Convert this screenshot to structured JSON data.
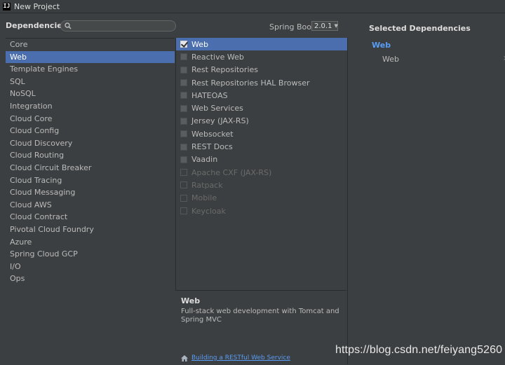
{
  "window": {
    "title": "New Project",
    "app_icon": "IJ"
  },
  "header": {
    "dependencies_label": "Dependencies",
    "search_placeholder": "",
    "spring_boot_label": "Spring Boot",
    "spring_boot_version": "2.0.1",
    "selected_dependencies_label": "Selected Dependencies"
  },
  "categories": [
    {
      "label": "Core",
      "selected": false
    },
    {
      "label": "Web",
      "selected": true
    },
    {
      "label": "Template Engines",
      "selected": false
    },
    {
      "label": "SQL",
      "selected": false
    },
    {
      "label": "NoSQL",
      "selected": false
    },
    {
      "label": "Integration",
      "selected": false
    },
    {
      "label": "Cloud Core",
      "selected": false
    },
    {
      "label": "Cloud Config",
      "selected": false
    },
    {
      "label": "Cloud Discovery",
      "selected": false
    },
    {
      "label": "Cloud Routing",
      "selected": false
    },
    {
      "label": "Cloud Circuit Breaker",
      "selected": false
    },
    {
      "label": "Cloud Tracing",
      "selected": false
    },
    {
      "label": "Cloud Messaging",
      "selected": false
    },
    {
      "label": "Cloud AWS",
      "selected": false
    },
    {
      "label": "Cloud Contract",
      "selected": false
    },
    {
      "label": "Pivotal Cloud Foundry",
      "selected": false
    },
    {
      "label": "Azure",
      "selected": false
    },
    {
      "label": "Spring Cloud GCP",
      "selected": false
    },
    {
      "label": "I/O",
      "selected": false
    },
    {
      "label": "Ops",
      "selected": false
    }
  ],
  "dependencies": [
    {
      "label": "Web",
      "checked": true,
      "selected": true,
      "disabled": false
    },
    {
      "label": "Reactive Web",
      "checked": false,
      "selected": false,
      "disabled": false
    },
    {
      "label": "Rest Repositories",
      "checked": false,
      "selected": false,
      "disabled": false
    },
    {
      "label": "Rest Repositories HAL Browser",
      "checked": false,
      "selected": false,
      "disabled": false
    },
    {
      "label": "HATEOAS",
      "checked": false,
      "selected": false,
      "disabled": false
    },
    {
      "label": "Web Services",
      "checked": false,
      "selected": false,
      "disabled": false
    },
    {
      "label": "Jersey (JAX-RS)",
      "checked": false,
      "selected": false,
      "disabled": false
    },
    {
      "label": "Websocket",
      "checked": false,
      "selected": false,
      "disabled": false
    },
    {
      "label": "REST Docs",
      "checked": false,
      "selected": false,
      "disabled": false
    },
    {
      "label": "Vaadin",
      "checked": false,
      "selected": false,
      "disabled": false
    },
    {
      "label": "Apache CXF (JAX-RS)",
      "checked": false,
      "selected": false,
      "disabled": true
    },
    {
      "label": "Ratpack",
      "checked": false,
      "selected": false,
      "disabled": true
    },
    {
      "label": "Mobile",
      "checked": false,
      "selected": false,
      "disabled": true
    },
    {
      "label": "Keycloak",
      "checked": false,
      "selected": false,
      "disabled": true
    }
  ],
  "description": {
    "title": "Web",
    "text": "Full-stack web development with Tomcat and Spring MVC",
    "guide_link": "Building a RESTful Web Service",
    "guide_icon": "home-icon"
  },
  "selected_dependencies": {
    "group": "Web",
    "items": [
      "Web"
    ]
  },
  "watermark": "https://blog.csdn.net/feiyang5260",
  "colors": {
    "background": "#3c3f41",
    "selection": "#4b6eaf",
    "link": "#589df6",
    "text": "#bbbbbb"
  }
}
